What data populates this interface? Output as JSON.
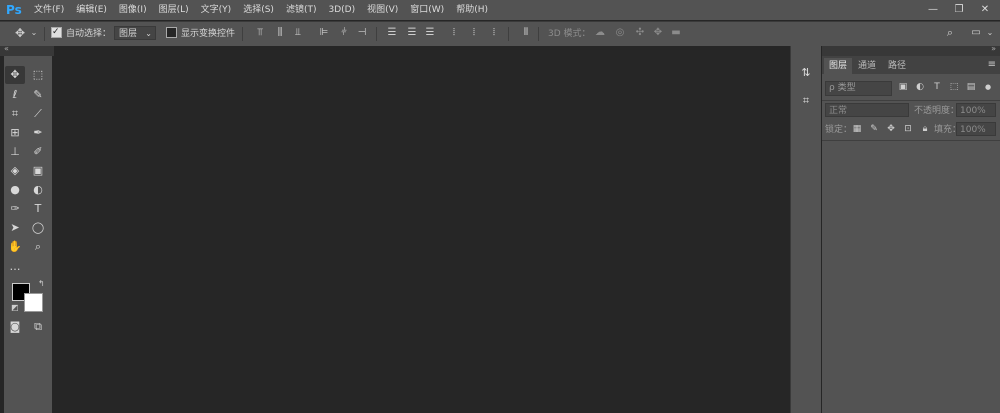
{
  "app": {
    "logo": "Ps"
  },
  "menu": [
    "文件(F)",
    "编辑(E)",
    "图像(I)",
    "图层(L)",
    "文字(Y)",
    "选择(S)",
    "滤镜(T)",
    "3D(D)",
    "视图(V)",
    "窗口(W)",
    "帮助(H)"
  ],
  "window_controls": {
    "minimize": "—",
    "restore": "❐",
    "close": "✕"
  },
  "options": {
    "auto_select_label": "自动选择：",
    "auto_select_checked": true,
    "auto_select_value": "图层",
    "show_transform_label": "显示变换控件",
    "show_transform_checked": false,
    "mode_3d_label": "3D 模式："
  },
  "layers_panel": {
    "tabs": [
      "图层",
      "通道",
      "路径"
    ],
    "search_placeholder": "ρ 类型",
    "blend_mode": "正常",
    "opacity_label": "不透明度：",
    "opacity_value": "100%",
    "lock_label": "锁定：",
    "fill_label": "填充：",
    "fill_value": "100%"
  },
  "colors": {
    "foreground": "#000000",
    "background": "#ffffff",
    "ui_panel": "#535353",
    "canvas": "#262626",
    "accent": "#31a8ff"
  },
  "icons": {
    "move": "move-icon",
    "marquee": "rect-marquee-icon",
    "lasso": "lasso-icon",
    "quick_select": "quick-select-icon",
    "crop": "crop-icon",
    "eyedropper": "eyedropper-icon",
    "healing": "healing-brush-icon",
    "brush": "brush-icon",
    "stamp": "clone-stamp-icon",
    "history_brush": "history-brush-icon",
    "eraser": "eraser-icon",
    "gradient": "gradient-icon",
    "blur": "blur-icon",
    "dodge": "dodge-icon",
    "pen": "pen-icon",
    "type": "type-icon",
    "path_select": "path-select-icon",
    "shape": "ellipse-icon",
    "hand": "hand-icon",
    "zoom": "zoom-icon",
    "more": "more-tools-icon"
  }
}
